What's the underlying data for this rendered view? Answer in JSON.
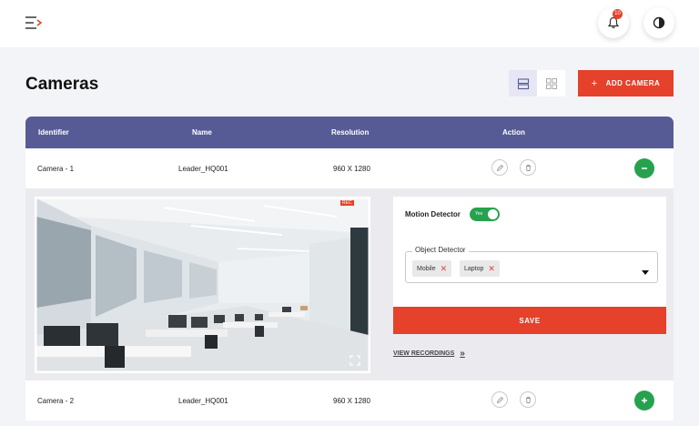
{
  "header": {
    "notification_count": "10",
    "icons": [
      "menu-toggle-icon",
      "bell-icon",
      "theme-toggle-icon"
    ]
  },
  "page": {
    "title": "Cameras",
    "add_button_label": "ADD CAMERA"
  },
  "table": {
    "columns": [
      "Identifier",
      "Name",
      "Resolution",
      "Action"
    ],
    "rows": [
      {
        "identifier": "Camera - 1",
        "name": "Leader_HQ001",
        "resolution": "960 X 1280",
        "expanded": true
      },
      {
        "identifier": "Camera - 2",
        "name": "Leader_HQ001",
        "resolution": "960 X 1280",
        "expanded": false
      }
    ]
  },
  "detail": {
    "rec_label": "REC",
    "motion_detector_label": "Motion Detector",
    "motion_detector_value": "Yes",
    "object_detector_label": "Object Detector",
    "object_tags": [
      "Mobile",
      "Laptop"
    ],
    "save_label": "SAVE",
    "view_recordings_label": "VIEW RECORDINGS"
  },
  "colors": {
    "accent": "#e5412b",
    "header_bg": "#565b96",
    "success": "#26a24e"
  }
}
